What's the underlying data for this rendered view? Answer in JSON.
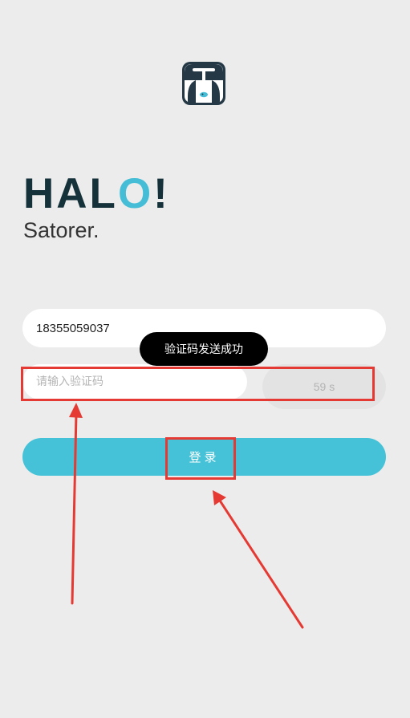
{
  "hero": {
    "title_main": "HAL",
    "title_accent": "O",
    "title_end": "!",
    "subtitle": "Satorer."
  },
  "form": {
    "phone_value": "18355059037",
    "code_placeholder": "请输入验证码",
    "countdown": "59 s",
    "login_label": "登录"
  },
  "toast": {
    "message": "验证码发送成功"
  },
  "colors": {
    "background": "#ececec",
    "accent": "#45c2d7",
    "title": "#15313a",
    "annotation": "#e53a33"
  },
  "icons": [
    "app-logo-icon"
  ]
}
